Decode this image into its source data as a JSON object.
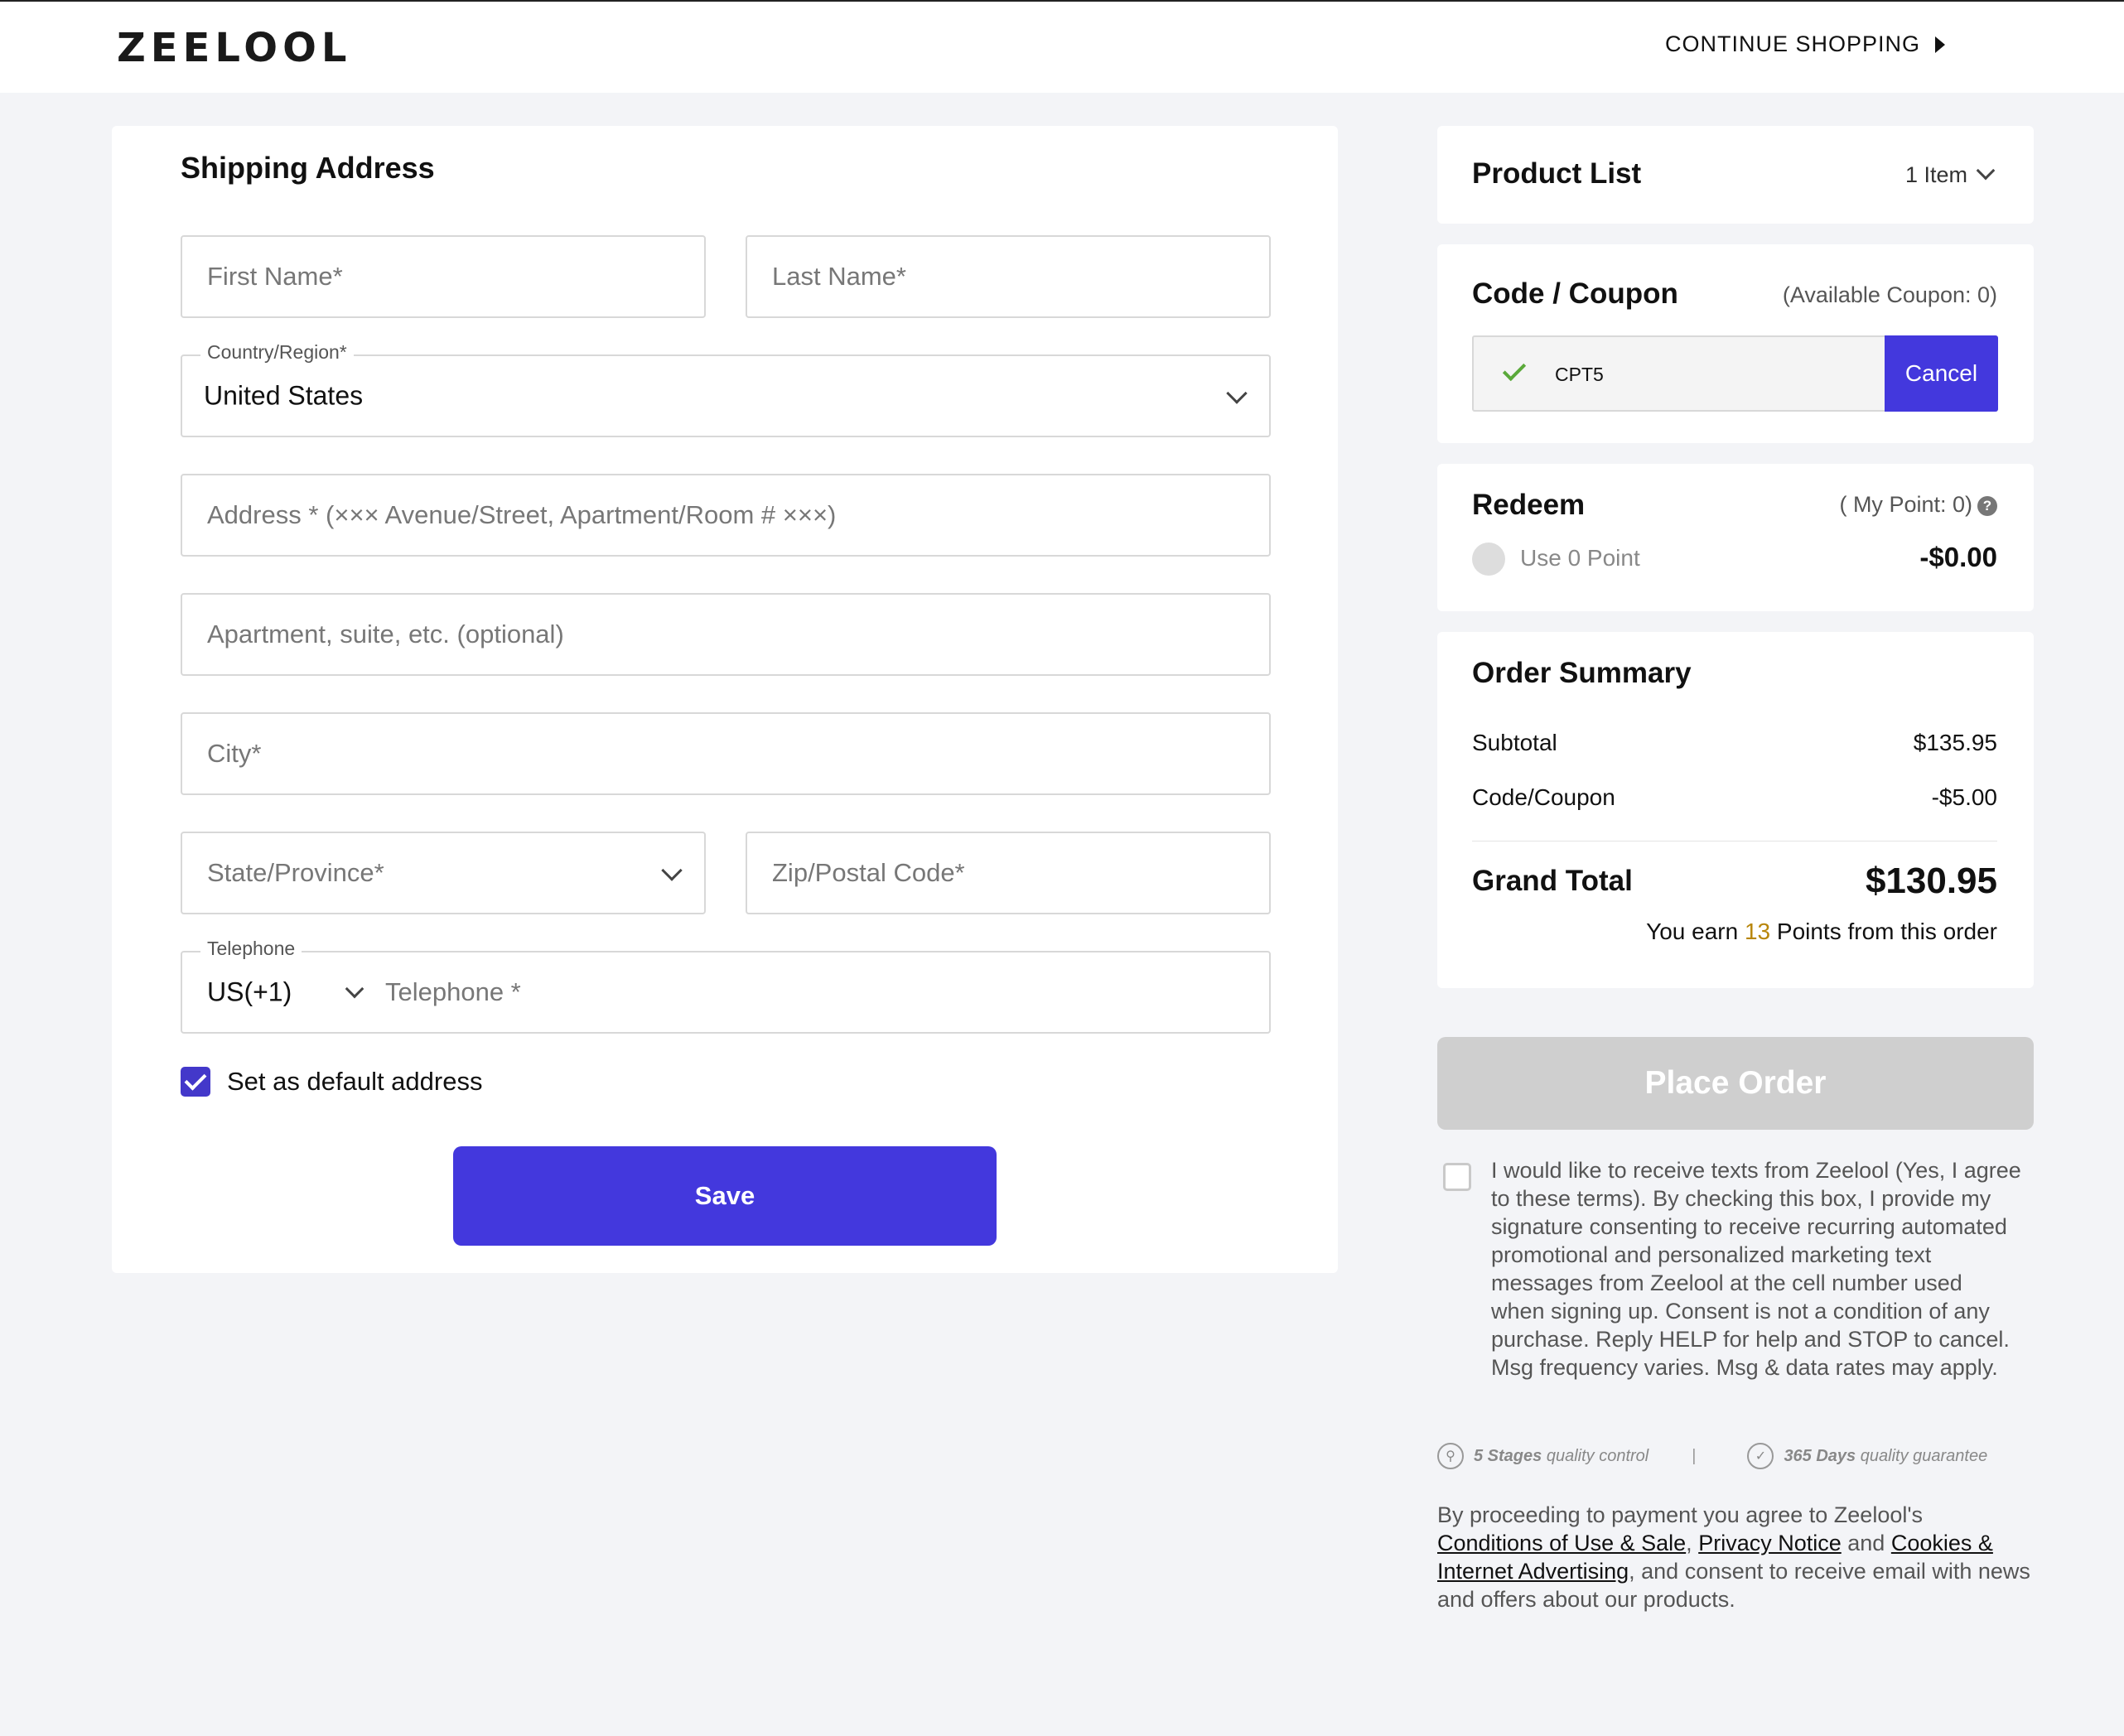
{
  "header": {
    "logo": "ZEELOOL",
    "continue_label": "CONTINUE SHOPPING"
  },
  "shipping": {
    "title": "Shipping Address",
    "first_name_ph": "First Name*",
    "last_name_ph": "Last Name*",
    "country_label": "Country/Region*",
    "country_value": "United States",
    "address_ph": "Address * (××× Avenue/Street, Apartment/Room # ×××)",
    "apartment_ph": "Apartment, suite, etc. (optional)",
    "city_ph": "City*",
    "state_ph": "State/Province*",
    "zip_ph": "Zip/Postal Code*",
    "telephone_label": "Telephone",
    "phone_code": "US(+1)",
    "telephone_ph": "Telephone *",
    "default_label": "Set as default address",
    "default_checked": true,
    "save_label": "Save"
  },
  "product_list": {
    "title": "Product List",
    "count": "1 Item"
  },
  "coupon": {
    "title": "Code / Coupon",
    "available": "(Available Coupon: 0)",
    "code": "CPT5",
    "cancel_label": "Cancel"
  },
  "redeem": {
    "title": "Redeem",
    "my_point": "( My Point: 0)",
    "help": "?",
    "use_label": "Use 0 Point",
    "amount": "-$0.00"
  },
  "summary": {
    "title": "Order Summary",
    "subtotal_label": "Subtotal",
    "subtotal_value": "$135.95",
    "coupon_label": "Code/Coupon",
    "coupon_value": "-$5.00",
    "grand_label": "Grand Total",
    "grand_value": "$130.95",
    "earn_prefix": "You earn",
    "earn_points": "13",
    "earn_suffix": "Points from this order"
  },
  "place_order_label": "Place Order",
  "sms_consent": "I would like to receive texts from Zeelool (Yes, I agree to these terms). By checking this box, I provide my signature consenting to receive recurring automated promotional and personalized marketing text messages from Zeelool at the cell number used when signing up. Consent is not a condition of any purchase. Reply HELP for help and STOP to cancel. Msg frequency varies. Msg & data rates may apply.",
  "quality": {
    "stages_num": "5 Stages",
    "stages_text": "quality control",
    "sep": "|",
    "days_num": "365 Days",
    "days_text": "quality guarantee"
  },
  "legal": {
    "prefix": "By proceeding to payment you agree to Zeelool's",
    "link1": "Conditions of Use & Sale",
    "comma": ",",
    "link2": "Privacy Notice",
    "and": "and",
    "link3": "Cookies & Internet Advertising",
    "suffix": ", and consent to receive email with news and offers about our products."
  },
  "colors": {
    "accent": "#4338dd",
    "success": "#5aa93a",
    "disabled": "#cfcfcf",
    "points": "#b8860b"
  }
}
